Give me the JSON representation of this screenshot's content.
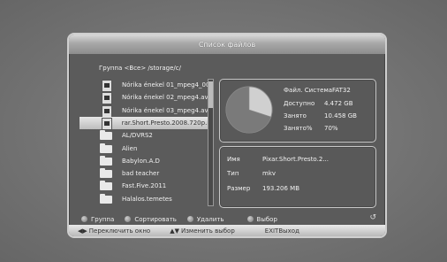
{
  "window": {
    "title": "Список файлов"
  },
  "path_bar": {
    "text": "Группа <Все> /storage/c/"
  },
  "files": [
    {
      "name": "Nórika énekel 01_mpeg4_002",
      "type": "video"
    },
    {
      "name": "Nórika énekel 02_mpeg4.avi",
      "type": "video"
    },
    {
      "name": "Nórika énekel 03_mpeg4.avi",
      "type": "video"
    },
    {
      "name": "rar.Short.Presto.2008.720p.Blu",
      "type": "video",
      "selected": true
    },
    {
      "name": "AL/DVRS2",
      "type": "folder"
    },
    {
      "name": "Alien",
      "type": "folder"
    },
    {
      "name": "Babylon.A.D",
      "type": "folder"
    },
    {
      "name": "bad teacher",
      "type": "folder"
    },
    {
      "name": "Fast.Five.2011",
      "type": "folder"
    },
    {
      "name": "Halalos.temetes",
      "type": "folder"
    }
  ],
  "disk_info": {
    "fs_label": "Файл. Система",
    "fs_value": "FAT32",
    "avail_label": "Доступно",
    "avail_value": "4.472 GB",
    "used_label": "Занято",
    "used_value": "10.458 GB",
    "used_pct_label": "Занято%",
    "used_pct_value": "70%",
    "used_fraction": 0.7
  },
  "file_details": {
    "name_label": "Имя",
    "name_value": "Pixar.Short.Presto.2...",
    "type_label": "Тип",
    "type_value": "mkv",
    "size_label": "Размер",
    "size_value": "193.206 MB"
  },
  "legend": {
    "group": "Группа",
    "sort": "Сортировать",
    "delete": "Удалить",
    "select": "Выбор"
  },
  "footer": {
    "switch_window": "Переключить окно",
    "change_selection": "Изменить выбор",
    "exit_key": "EXIT",
    "exit_label": "Выход"
  },
  "colors": {
    "pie_used": "#7a7a7a",
    "pie_free": "#d0d0d0"
  },
  "icons": {
    "video_file": "video-file-icon",
    "folder": "folder-icon",
    "back": "back-icon"
  }
}
